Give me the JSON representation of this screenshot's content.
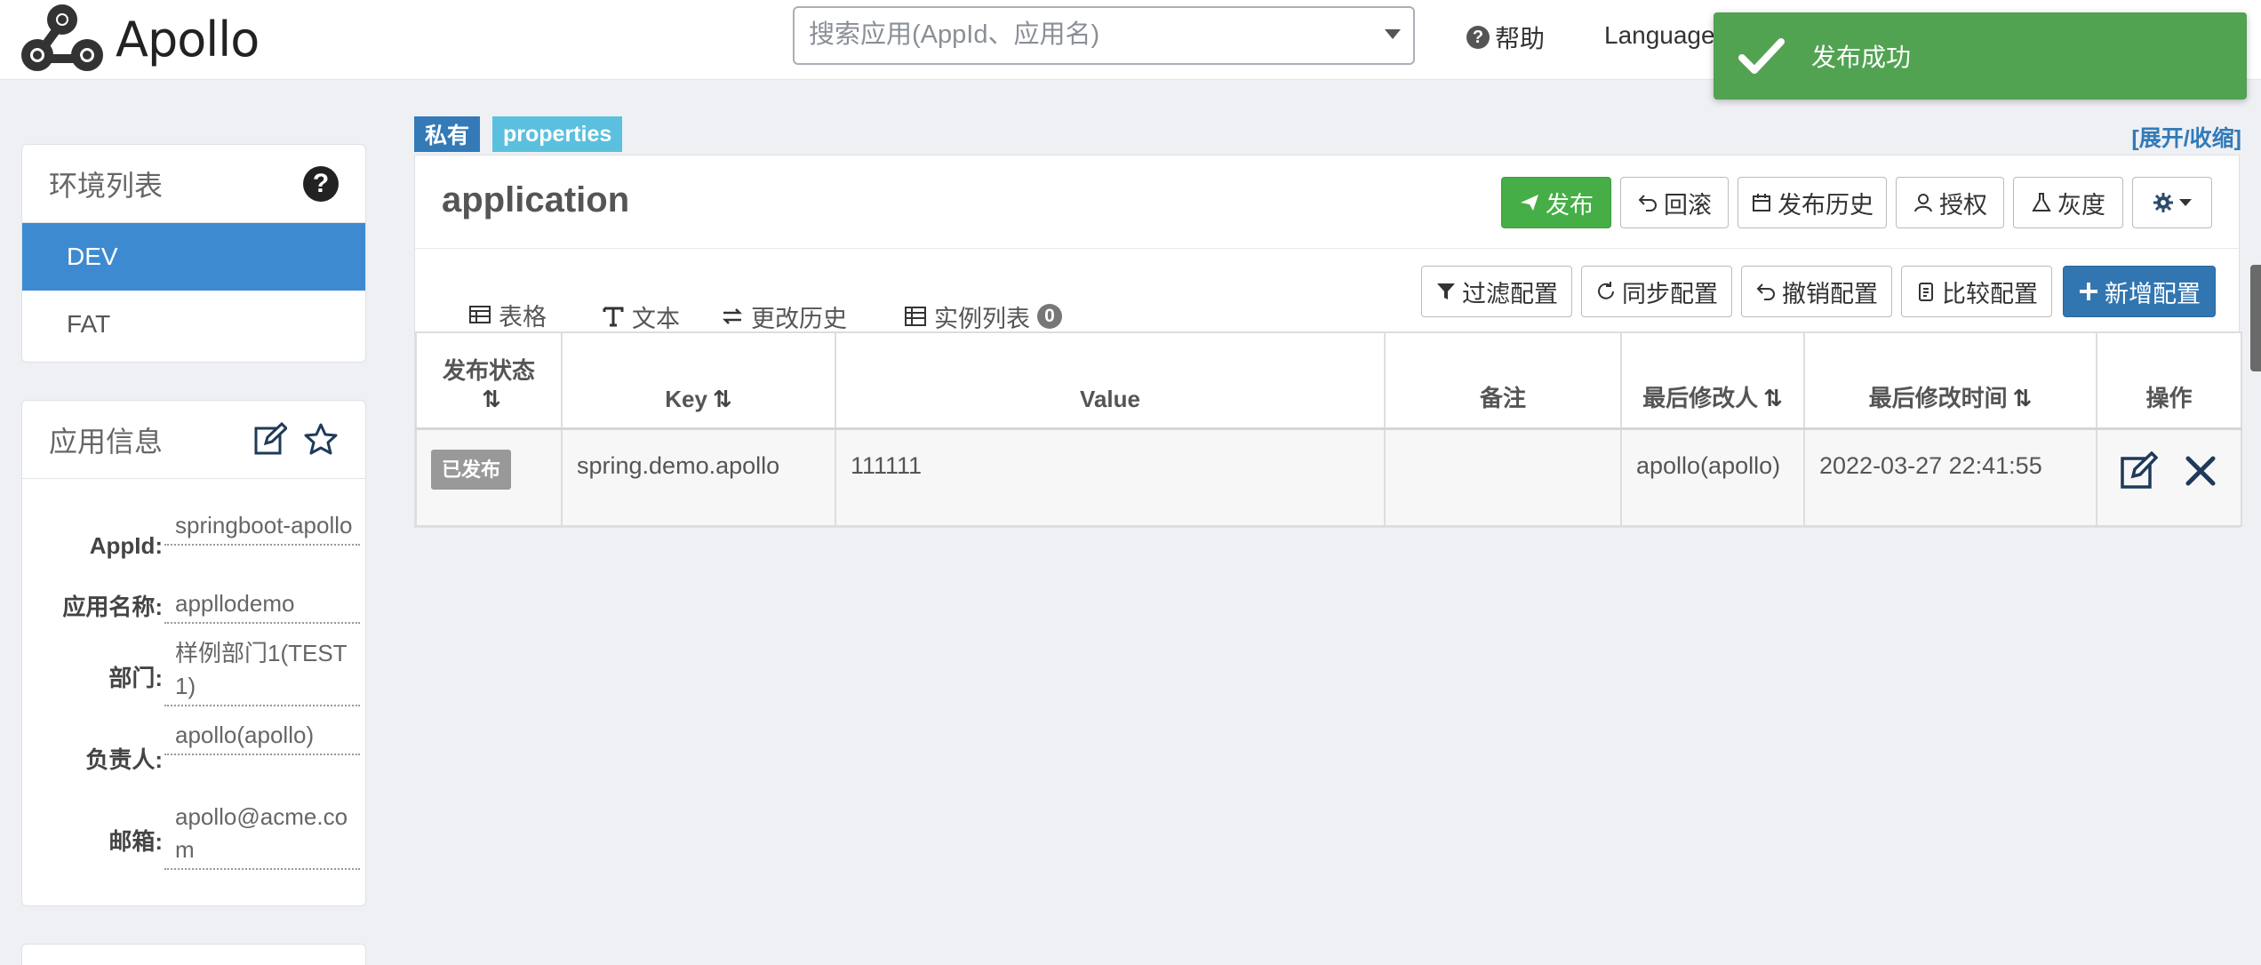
{
  "header": {
    "logo_text": "Apollo",
    "search_placeholder": "搜索应用(AppId、应用名)",
    "help_label": "帮助",
    "language_label": "Language"
  },
  "toast": {
    "message": "发布成功"
  },
  "env_panel": {
    "title": "环境列表",
    "items": [
      {
        "label": "DEV",
        "active": true
      },
      {
        "label": "FAT",
        "active": false
      }
    ]
  },
  "app_info": {
    "title": "应用信息",
    "fields": [
      {
        "label": "AppId:",
        "value": "springboot-apollo"
      },
      {
        "label": "应用名称:",
        "value": "appllodemo"
      },
      {
        "label": "部门:",
        "value": "样例部门1(TEST1)"
      },
      {
        "label": "负责人:",
        "value": "apollo(apollo)"
      },
      {
        "label": "邮箱:",
        "value": "apollo@acme.com"
      }
    ]
  },
  "namespace": {
    "tag_private": "私有",
    "tag_format": "properties",
    "expand_label": "[展开/收缩]",
    "name": "application",
    "actions": {
      "publish": "发布",
      "rollback": "回滚",
      "history": "发布历史",
      "authorize": "授权",
      "gray": "灰度"
    },
    "tabs": [
      {
        "label": "表格",
        "icon": "table-icon",
        "active": true
      },
      {
        "label": "文本",
        "icon": "text-icon",
        "active": false
      },
      {
        "label": "更改历史",
        "icon": "history-icon",
        "active": false
      },
      {
        "label": "实例列表",
        "icon": "instance-icon",
        "active": false,
        "badge": "0"
      }
    ],
    "tools": {
      "filter": "过滤配置",
      "sync": "同步配置",
      "revoke": "撤销配置",
      "compare": "比较配置",
      "add": "新增配置"
    },
    "table": {
      "headers": {
        "status": "发布状态",
        "key": "Key",
        "value": "Value",
        "comment": "备注",
        "modifier": "最后修改人",
        "modified_time": "最后修改时间",
        "actions": "操作"
      },
      "rows": [
        {
          "status": "已发布",
          "key": "spring.demo.apollo",
          "value": "111111",
          "comment": "",
          "modifier": "apollo(apollo)",
          "modified_time": "2022-03-27 22:41:55"
        }
      ]
    }
  }
}
